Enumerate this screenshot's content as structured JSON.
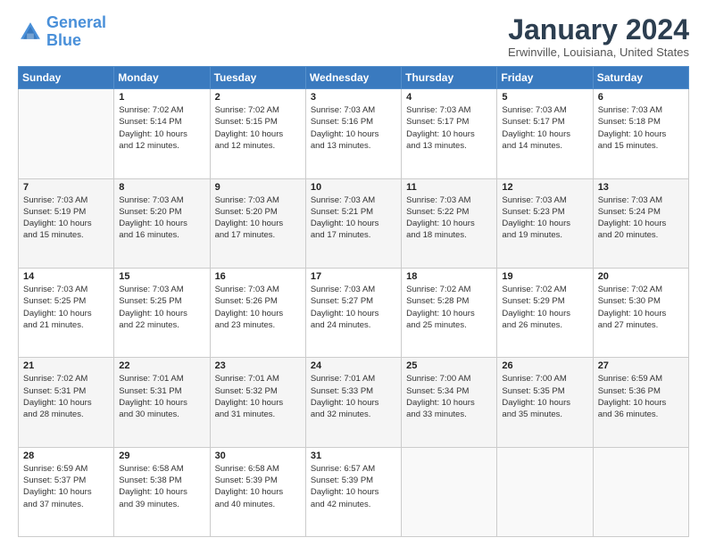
{
  "logo": {
    "line1": "General",
    "line2": "Blue"
  },
  "title": "January 2024",
  "subtitle": "Erwinville, Louisiana, United States",
  "weekdays": [
    "Sunday",
    "Monday",
    "Tuesday",
    "Wednesday",
    "Thursday",
    "Friday",
    "Saturday"
  ],
  "weeks": [
    [
      {
        "day": "",
        "info": ""
      },
      {
        "day": "1",
        "info": "Sunrise: 7:02 AM\nSunset: 5:14 PM\nDaylight: 10 hours\nand 12 minutes."
      },
      {
        "day": "2",
        "info": "Sunrise: 7:02 AM\nSunset: 5:15 PM\nDaylight: 10 hours\nand 12 minutes."
      },
      {
        "day": "3",
        "info": "Sunrise: 7:03 AM\nSunset: 5:16 PM\nDaylight: 10 hours\nand 13 minutes."
      },
      {
        "day": "4",
        "info": "Sunrise: 7:03 AM\nSunset: 5:17 PM\nDaylight: 10 hours\nand 13 minutes."
      },
      {
        "day": "5",
        "info": "Sunrise: 7:03 AM\nSunset: 5:17 PM\nDaylight: 10 hours\nand 14 minutes."
      },
      {
        "day": "6",
        "info": "Sunrise: 7:03 AM\nSunset: 5:18 PM\nDaylight: 10 hours\nand 15 minutes."
      }
    ],
    [
      {
        "day": "7",
        "info": "Sunrise: 7:03 AM\nSunset: 5:19 PM\nDaylight: 10 hours\nand 15 minutes."
      },
      {
        "day": "8",
        "info": "Sunrise: 7:03 AM\nSunset: 5:20 PM\nDaylight: 10 hours\nand 16 minutes."
      },
      {
        "day": "9",
        "info": "Sunrise: 7:03 AM\nSunset: 5:20 PM\nDaylight: 10 hours\nand 17 minutes."
      },
      {
        "day": "10",
        "info": "Sunrise: 7:03 AM\nSunset: 5:21 PM\nDaylight: 10 hours\nand 17 minutes."
      },
      {
        "day": "11",
        "info": "Sunrise: 7:03 AM\nSunset: 5:22 PM\nDaylight: 10 hours\nand 18 minutes."
      },
      {
        "day": "12",
        "info": "Sunrise: 7:03 AM\nSunset: 5:23 PM\nDaylight: 10 hours\nand 19 minutes."
      },
      {
        "day": "13",
        "info": "Sunrise: 7:03 AM\nSunset: 5:24 PM\nDaylight: 10 hours\nand 20 minutes."
      }
    ],
    [
      {
        "day": "14",
        "info": "Sunrise: 7:03 AM\nSunset: 5:25 PM\nDaylight: 10 hours\nand 21 minutes."
      },
      {
        "day": "15",
        "info": "Sunrise: 7:03 AM\nSunset: 5:25 PM\nDaylight: 10 hours\nand 22 minutes."
      },
      {
        "day": "16",
        "info": "Sunrise: 7:03 AM\nSunset: 5:26 PM\nDaylight: 10 hours\nand 23 minutes."
      },
      {
        "day": "17",
        "info": "Sunrise: 7:03 AM\nSunset: 5:27 PM\nDaylight: 10 hours\nand 24 minutes."
      },
      {
        "day": "18",
        "info": "Sunrise: 7:02 AM\nSunset: 5:28 PM\nDaylight: 10 hours\nand 25 minutes."
      },
      {
        "day": "19",
        "info": "Sunrise: 7:02 AM\nSunset: 5:29 PM\nDaylight: 10 hours\nand 26 minutes."
      },
      {
        "day": "20",
        "info": "Sunrise: 7:02 AM\nSunset: 5:30 PM\nDaylight: 10 hours\nand 27 minutes."
      }
    ],
    [
      {
        "day": "21",
        "info": "Sunrise: 7:02 AM\nSunset: 5:31 PM\nDaylight: 10 hours\nand 28 minutes."
      },
      {
        "day": "22",
        "info": "Sunrise: 7:01 AM\nSunset: 5:31 PM\nDaylight: 10 hours\nand 30 minutes."
      },
      {
        "day": "23",
        "info": "Sunrise: 7:01 AM\nSunset: 5:32 PM\nDaylight: 10 hours\nand 31 minutes."
      },
      {
        "day": "24",
        "info": "Sunrise: 7:01 AM\nSunset: 5:33 PM\nDaylight: 10 hours\nand 32 minutes."
      },
      {
        "day": "25",
        "info": "Sunrise: 7:00 AM\nSunset: 5:34 PM\nDaylight: 10 hours\nand 33 minutes."
      },
      {
        "day": "26",
        "info": "Sunrise: 7:00 AM\nSunset: 5:35 PM\nDaylight: 10 hours\nand 35 minutes."
      },
      {
        "day": "27",
        "info": "Sunrise: 6:59 AM\nSunset: 5:36 PM\nDaylight: 10 hours\nand 36 minutes."
      }
    ],
    [
      {
        "day": "28",
        "info": "Sunrise: 6:59 AM\nSunset: 5:37 PM\nDaylight: 10 hours\nand 37 minutes."
      },
      {
        "day": "29",
        "info": "Sunrise: 6:58 AM\nSunset: 5:38 PM\nDaylight: 10 hours\nand 39 minutes."
      },
      {
        "day": "30",
        "info": "Sunrise: 6:58 AM\nSunset: 5:39 PM\nDaylight: 10 hours\nand 40 minutes."
      },
      {
        "day": "31",
        "info": "Sunrise: 6:57 AM\nSunset: 5:39 PM\nDaylight: 10 hours\nand 42 minutes."
      },
      {
        "day": "",
        "info": ""
      },
      {
        "day": "",
        "info": ""
      },
      {
        "day": "",
        "info": ""
      }
    ]
  ]
}
